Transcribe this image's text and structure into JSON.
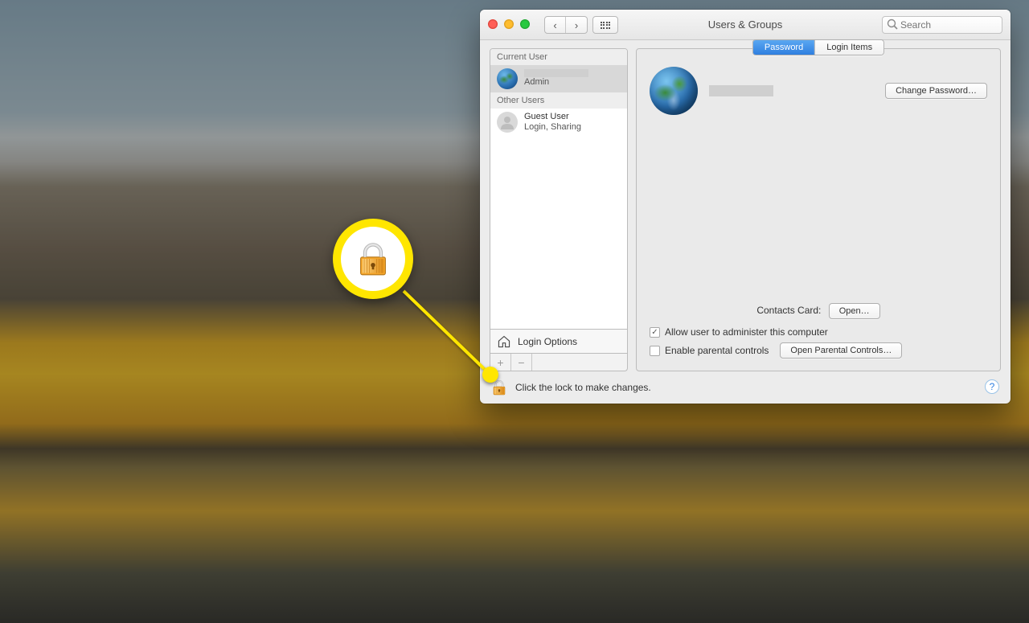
{
  "window": {
    "title": "Users & Groups",
    "search_placeholder": "Search"
  },
  "sidebar": {
    "current_header": "Current User",
    "other_header": "Other Users",
    "current_user": {
      "role": "Admin"
    },
    "guest": {
      "name": "Guest User",
      "sub": "Login, Sharing"
    },
    "login_options": "Login Options"
  },
  "tabs": {
    "password": "Password",
    "login_items": "Login Items"
  },
  "detail": {
    "change_password": "Change Password…",
    "contacts_label": "Contacts Card:",
    "open": "Open…",
    "admin_check": "Allow user to administer this computer",
    "parental_check": "Enable parental controls",
    "parental_button": "Open Parental Controls…"
  },
  "lockbar": {
    "text": "Click the lock to make changes."
  }
}
